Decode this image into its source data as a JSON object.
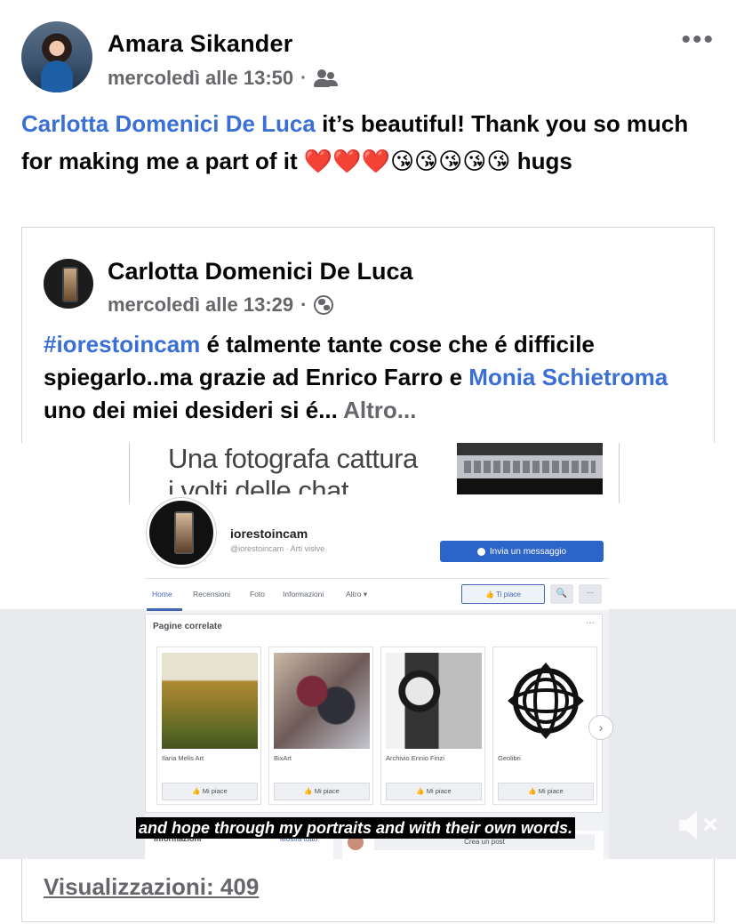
{
  "post": {
    "author": "Amara Sikander",
    "timestamp": "mercoledì alle 13:50",
    "separator": "·",
    "audience_icon": "friends-icon",
    "more_label": "•••",
    "text": {
      "mention": "Carlotta Domenici De Luca",
      "body": " it’s beautiful! Thank you so much for making me a part of it ❤️❤️❤️😘😘😘😘😘 hugs"
    }
  },
  "shared_post": {
    "author": "Carlotta Domenici De Luca",
    "timestamp": "mercoledì alle 13:29",
    "separator": "·",
    "audience_icon": "globe-icon",
    "hashtag": "#iorestoincam",
    "text_part1": " é talmente tante cose che é difficile spiegarlo..ma grazie ad Enrico Farro e ",
    "mention": "Monia Schietroma",
    "text_part2": " uno dei miei desideri si é... ",
    "more_link": "Altro..."
  },
  "video": {
    "headline_line1": "Una fotografa cattura",
    "headline_line2": "i volti delle chat",
    "page_name": "iorestoincam",
    "page_handle": "@iorestoincam · Arti visive",
    "message_button": "Invia un messaggio",
    "nav": [
      "Home",
      "Recensioni",
      "Foto",
      "Informazioni",
      "Altro ▾"
    ],
    "like_button": "👍 Ti piace",
    "search_glyph": "🔍",
    "dots_glyph": "···",
    "related_title": "Pagine correlate",
    "related_dots": "···",
    "related_pages": [
      {
        "name": "Ilaria Melis Art",
        "like": "👍 Mi piace"
      },
      {
        "name": "BixArt",
        "like": "👍 Mi piace"
      },
      {
        "name": "Archivio Ennio Finzi",
        "like": "👍 Mi piace"
      },
      {
        "name": "Geolibri",
        "like": "👍 Mi piace"
      }
    ],
    "next_glyph": "›",
    "info_label": "Informazioni",
    "info_link": "Mostra tutto",
    "create_post": "Crea un post",
    "subtitle": "and hope through my portraits and with their own words.",
    "mute_icon": "speaker-muted-icon"
  },
  "views": {
    "text": "Visualizzazioni: 409"
  },
  "colors": {
    "link_blue": "#3a6fd6",
    "meta_grey": "#65676b",
    "fb_blue": "#2d64c8"
  }
}
